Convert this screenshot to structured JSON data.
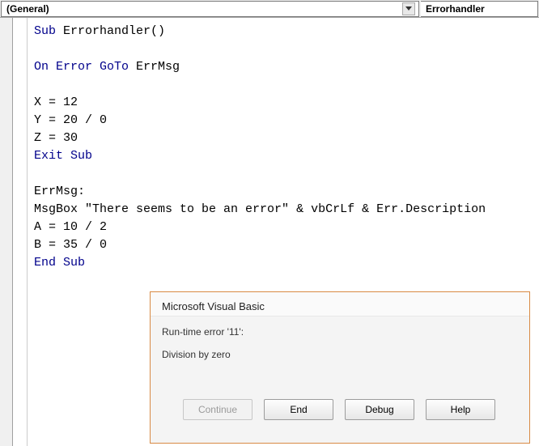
{
  "toolbar": {
    "left_dropdown": "(General)",
    "right_dropdown": "Errorhandler"
  },
  "code": {
    "l1a": "Sub ",
    "l1b": "Errorhandler()",
    "l3a": "On Error GoTo ",
    "l3b": "ErrMsg",
    "l5": "X = 12",
    "l6": "Y = 20 / 0",
    "l7": "Z = 30",
    "l8": "Exit Sub",
    "l10": "ErrMsg:",
    "l11a": "MsgBox ",
    "l11b": "\"There seems to be an error\"",
    "l11c": " & vbCrLf & Err.Description ",
    "l12": "A = 10 / 2",
    "l13": "B = 35 / 0",
    "l14": "End Sub"
  },
  "dialog": {
    "title": "Microsoft Visual Basic",
    "error_line": "Run-time error '11':",
    "error_msg": "Division by zero",
    "buttons": {
      "continue": "Continue",
      "end": "End",
      "debug": "Debug",
      "help": "Help"
    }
  }
}
